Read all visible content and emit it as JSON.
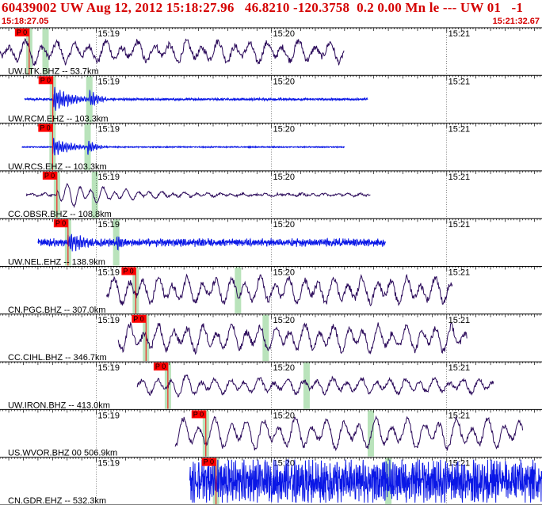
{
  "header": {
    "title": "60439002 UW Aug 12, 2012 15:18:27.96   46.8210 -120.3758  0.2 0.00 Mn le --- UW 01   -1",
    "start_time": "15:18:27.05",
    "end_time": "15:21:32.67"
  },
  "colors": {
    "header_text": "#d40000",
    "trace_blue": "#0a17e6",
    "trace_purple": "#2b0a5a",
    "phase_marker": "#ff0000",
    "pick_band": "#b9e3bb"
  },
  "chart_data": {
    "type": "seismogram",
    "time_start_s": 0,
    "time_end_s": 185.62,
    "time_ticks": [
      {
        "label": "15:19",
        "t": 32.95
      },
      {
        "label": "15:20",
        "t": 92.95
      },
      {
        "label": "15:21",
        "t": 152.95
      }
    ],
    "traces": [
      {
        "label": "UW.LTK.BHZ -- 53.7km",
        "color": "trace_purple",
        "t_start": 0.0,
        "t_end": 118.0,
        "p_pick": 10.0,
        "s_pick": 15.6,
        "p_label": "P 0",
        "amplitude": 0.55,
        "event_amp": 0.8,
        "noise": 0.15,
        "period_s": 5.5
      },
      {
        "label": "UW.RCM.EHZ -- 103.3km",
        "color": "trace_blue",
        "t_start": 8.5,
        "t_end": 126.0,
        "p_pick": 18.1,
        "s_pick": 30.6,
        "p_label": "P 0",
        "amplitude": 0.02,
        "event_amp": 0.75,
        "noise": 0.04,
        "period_s": 0.6
      },
      {
        "label": "UW.RCS.EHZ -- 103.3km",
        "color": "trace_blue",
        "t_start": 7.5,
        "t_end": 118.0,
        "p_pick": 18.0,
        "s_pick": 30.0,
        "p_label": "P 0",
        "amplitude": 0.01,
        "event_amp": 0.55,
        "noise": 0.02,
        "period_s": 0.6
      },
      {
        "label": "CC.OBSR.BHZ -- 108.8km",
        "color": "trace_purple",
        "t_start": 9.0,
        "t_end": 127.0,
        "p_pick": 19.5,
        "s_pick": 32.5,
        "p_label": "P 0",
        "amplitude": 0.06,
        "event_amp": 0.75,
        "noise": 0.05,
        "period_s": 4.0
      },
      {
        "label": "UW.NEL.EHZ -- 138.9km",
        "color": "trace_blue",
        "t_start": 13.0,
        "t_end": 132.0,
        "p_pick": 23.3,
        "s_pick": 39.8,
        "p_label": "P 0",
        "amplitude": 0.1,
        "event_amp": 0.55,
        "noise": 0.12,
        "period_s": 0.6
      },
      {
        "label": "CN.PGC.BHZ -- 307.0km",
        "color": "trace_purple",
        "t_start": 36.5,
        "t_end": 155.0,
        "p_pick": 46.5,
        "s_pick": 81.5,
        "p_label": "P 0",
        "amplitude": 0.7,
        "event_amp": 0.8,
        "noise": 0.15,
        "period_s": 5.0
      },
      {
        "label": "CC.CIHL.BHZ -- 346.7km",
        "color": "trace_purple",
        "t_start": 40.5,
        "t_end": 160.0,
        "p_pick": 50.0,
        "s_pick": 91.0,
        "p_label": "P 0",
        "amplitude": 0.7,
        "event_amp": 0.8,
        "noise": 0.15,
        "period_s": 5.0
      },
      {
        "label": "UW.IRON.BHZ -- 413.0km",
        "color": "trace_purple",
        "t_start": 47.0,
        "t_end": 169.0,
        "p_pick": 57.5,
        "s_pick": 105.0,
        "p_label": "P 0",
        "amplitude": 0.4,
        "event_amp": 0.75,
        "noise": 0.1,
        "period_s": 5.0
      },
      {
        "label": "US.WVOR.BHZ 00 506.9km",
        "color": "trace_purple",
        "t_start": 60.0,
        "t_end": 179.0,
        "p_pick": 70.5,
        "s_pick": 127.0,
        "p_label": "P 0",
        "amplitude": 0.8,
        "event_amp": 0.75,
        "noise": 0.12,
        "period_s": 5.5
      },
      {
        "label": "CN.GDR.EHZ -- 532.3km",
        "color": "trace_blue",
        "t_start": 65.0,
        "t_end": 185.62,
        "p_pick": 74.0,
        "s_pick": 133.0,
        "p_label": "P 0",
        "amplitude": 0.6,
        "event_amp": 0.6,
        "noise": 0.7,
        "period_s": 0.6
      }
    ]
  }
}
